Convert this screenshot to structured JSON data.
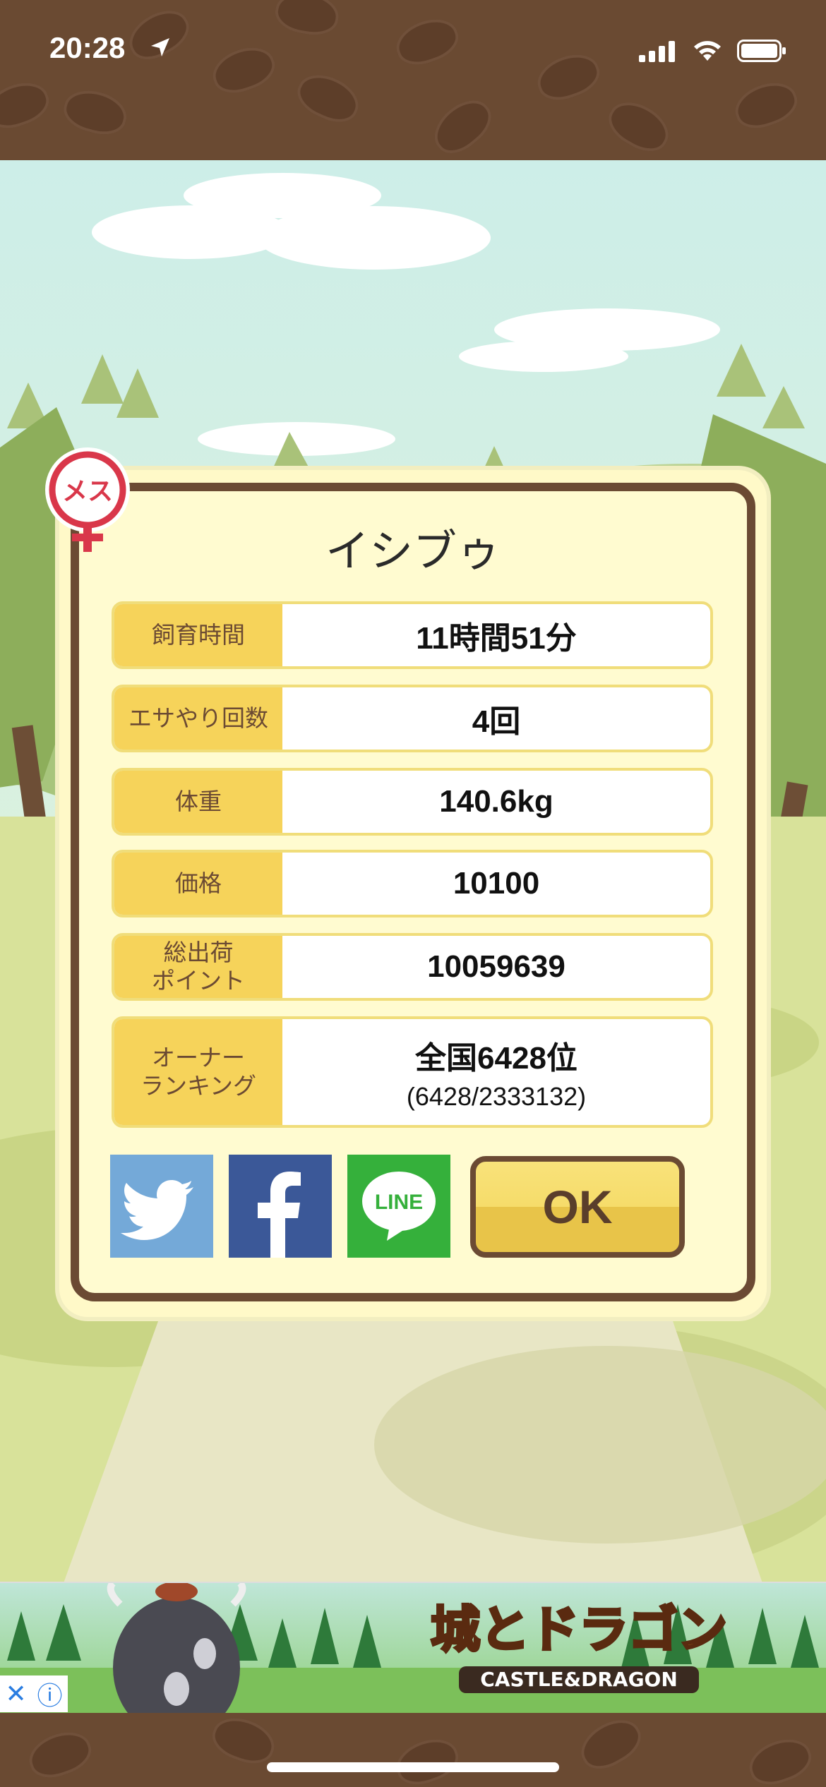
{
  "status_bar": {
    "time": "20:28",
    "icons": [
      "location-arrow-icon",
      "signal-icon",
      "wifi-icon",
      "battery-icon"
    ]
  },
  "pet": {
    "gender_badge": "メス",
    "name": "イシブゥ"
  },
  "stats": [
    {
      "label": "飼育時間",
      "value": "11時間51分"
    },
    {
      "label": "エサやり回数",
      "value": "4回"
    },
    {
      "label": "体重",
      "value": "140.6kg"
    },
    {
      "label": "価格",
      "value": "10100"
    },
    {
      "label": "総出荷\nポイント",
      "value": "10059639"
    },
    {
      "label": "オーナー\nランキング",
      "value": "全国6428位",
      "sub": "(6428/2333132)"
    }
  ],
  "share": {
    "twitter": "twitter-icon",
    "facebook": "facebook-icon",
    "line": "LINE"
  },
  "ok_label": "OK",
  "ad": {
    "title": "城とドラゴン",
    "subtitle": "CASTLE&DRAGON"
  },
  "colors": {
    "brown": "#6b4a33",
    "panel": "#fffbd0",
    "label_yellow": "#f6d35a",
    "twitter": "#74a9d8",
    "facebook": "#3b5898",
    "line": "#35b03b",
    "gender_red": "#d9374a"
  }
}
